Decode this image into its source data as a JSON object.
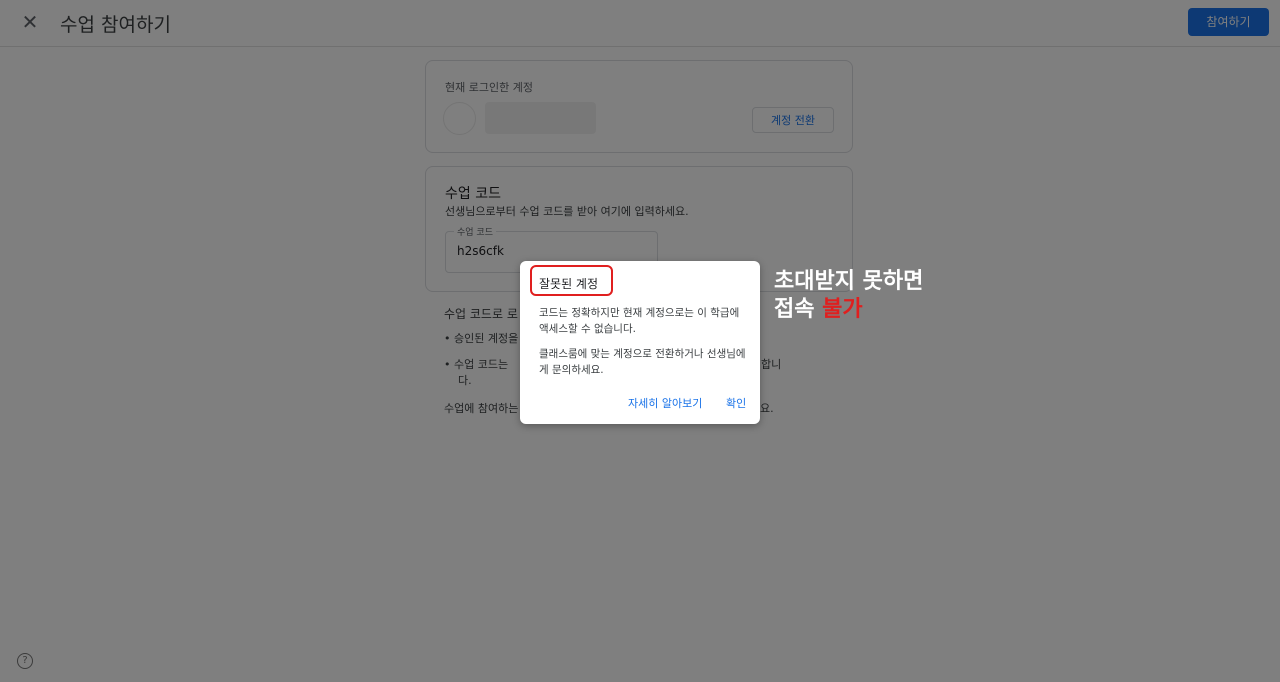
{
  "header": {
    "close_icon": "close-icon",
    "title": "수업 참여하기",
    "join_button": "참여하기"
  },
  "account_card": {
    "label": "현재 로그인한 계정",
    "switch_button": "계정 전환"
  },
  "class_code_card": {
    "title": "수업 코드",
    "description": "선생님으로부터 수업 코드를 받아 여기에 입력하세요.",
    "field_label": "수업 코드",
    "field_value": "h2s6cfk"
  },
  "info": {
    "heading": "수업 코드로 로",
    "bullet1": "승인된 계정을",
    "bullet2_start": "수업 코드는 ",
    "bullet2_end": "자리여야 합니",
    "bullet2_wrap": "다.",
    "footer_start": "수업에 참여하는",
    "footer_end": "요."
  },
  "dialog": {
    "title": "잘못된 계정",
    "body1": "코드는 정확하지만 현재 계정으로는 이 학급에 액세스할 수 없습니다.",
    "body2": "클래스룸에 맞는 계정으로 전환하거나 선생님에게 문의하세요.",
    "learn_more": "자세히 알아보기",
    "ok": "확인"
  },
  "annotation": {
    "line1": "초대받지 못하면",
    "line2_prefix": "접속 ",
    "line2_red": "불가"
  },
  "help_icon": "help-icon",
  "colors": {
    "accent": "#1a73e8",
    "highlight": "#e01f1f"
  }
}
